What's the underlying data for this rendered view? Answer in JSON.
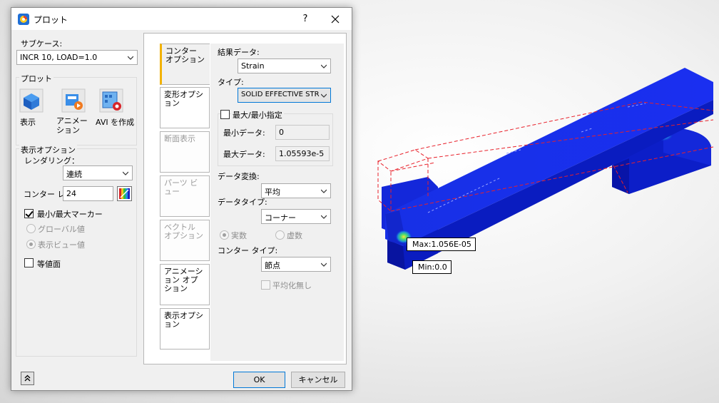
{
  "dialog": {
    "title": "プロット",
    "help_label": "?",
    "subcase_label": "サブケース:",
    "subcase_value": "INCR 10, LOAD=1.0",
    "plot_group_label": "プロット",
    "plot_buttons": [
      {
        "label": "表示",
        "icon": "display-icon"
      },
      {
        "label": "アニメーション",
        "icon": "animation-icon"
      },
      {
        "label": "AVI を作成",
        "icon": "avi-create-icon"
      }
    ],
    "display_options_label": "表示オプション",
    "rendering_label": "レンダリング：",
    "rendering_value": "連続",
    "contour_level_label": "コンター レ",
    "contour_level_value": "24",
    "minmax_marker_label": "最小/最大マーカー",
    "minmax_marker_checked": true,
    "global_value_label": "グローバル値",
    "display_view_value_label": "表示ビュー値",
    "isosurface_label": "等値面",
    "isosurface_checked": false,
    "tabs": [
      {
        "label": "コンター オプション",
        "checked": true,
        "enabled": true,
        "active": true
      },
      {
        "label": "変形オプション",
        "checked": true,
        "enabled": true,
        "active": false
      },
      {
        "label": "断面表示",
        "checked": false,
        "enabled": false,
        "active": false
      },
      {
        "label": "パーツ ビュー",
        "checked": false,
        "enabled": false,
        "active": false
      },
      {
        "label": "ベクトル オプション",
        "checked": false,
        "enabled": false,
        "active": false
      },
      {
        "label": "アニメーション オプション",
        "checked": null,
        "enabled": true,
        "active": false
      },
      {
        "label": "表示オプション",
        "checked": null,
        "enabled": true,
        "active": false
      }
    ],
    "contour": {
      "result_data_label": "結果データ:",
      "result_data_value": "Strain",
      "type_label": "タイプ:",
      "type_value": "SOLID EFFECTIVE STR",
      "minmax_spec_label": "最大/最小指定",
      "min_data_label": "最小データ:",
      "min_data_value": "0",
      "max_data_label": "最大データ:",
      "max_data_value": "1.05593e-5",
      "data_transform_label": "データ変換:",
      "data_transform_value": "平均",
      "data_type_label": "データタイプ:",
      "data_type_value": "コーナー",
      "real_label": "実数",
      "imag_label": "虚数",
      "contour_type_label": "コンター タイプ:",
      "contour_type_value": "節点",
      "no_averaging_label": "平均化無し"
    },
    "ok_label": "OK",
    "cancel_label": "キャンセル"
  },
  "viewport": {
    "max_label": "Max:1.056E-05",
    "min_label": "Min:0.0"
  },
  "colors": {
    "model_blue": "#0a1fd0",
    "deformed_outline": "#e8202a",
    "tab_accent": "#f2b200"
  }
}
